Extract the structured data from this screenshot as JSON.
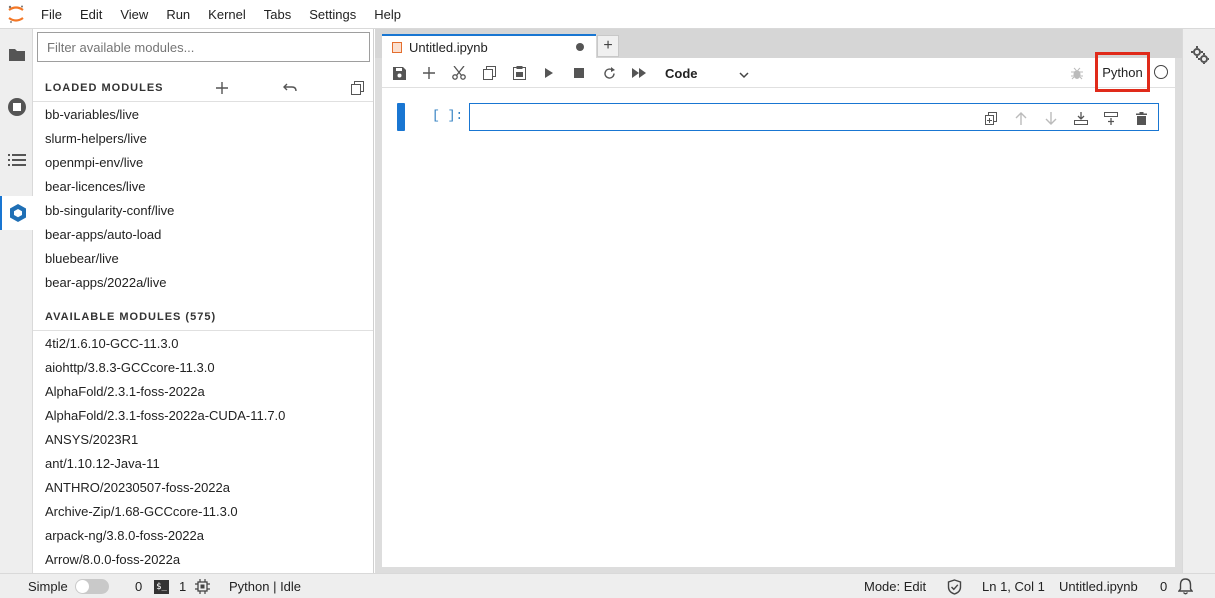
{
  "menu": [
    "File",
    "Edit",
    "View",
    "Run",
    "Kernel",
    "Tabs",
    "Settings",
    "Help"
  ],
  "sidebar": {
    "filter_placeholder": "Filter available modules...",
    "loaded_title": "LOADED MODULES",
    "loaded_modules": [
      "bb-variables/live",
      "slurm-helpers/live",
      "openmpi-env/live",
      "bear-licences/live",
      "bb-singularity-conf/live",
      "bear-apps/auto-load",
      "bluebear/live",
      "bear-apps/2022a/live"
    ],
    "available_title": "AVAILABLE MODULES (575)",
    "available_modules": [
      "4ti2/1.6.10-GCC-11.3.0",
      "aiohttp/3.8.3-GCCcore-11.3.0",
      "AlphaFold/2.3.1-foss-2022a",
      "AlphaFold/2.3.1-foss-2022a-CUDA-11.7.0",
      "ANSYS/2023R1",
      "ant/1.10.12-Java-11",
      "ANTHRO/20230507-foss-2022a",
      "Archive-Zip/1.68-GCCcore-11.3.0",
      "arpack-ng/3.8.0-foss-2022a",
      "Arrow/8.0.0-foss-2022a"
    ]
  },
  "notebook": {
    "tab_title": "Untitled.ipynb",
    "cell_type": "Code",
    "kernel_name": "Python",
    "cell_prompt": "[ ]:"
  },
  "status": {
    "mode_toggle_label": "Simple",
    "terminals_count": "0",
    "kernels_count": "1",
    "kernel_status": "Python | Idle",
    "mode": "Mode: Edit",
    "cursor": "Ln 1, Col 1",
    "filename": "Untitled.ipynb",
    "notifications": "0"
  },
  "colors": {
    "accent": "#1976d2",
    "highlight_box": "#e02a1a",
    "jupyter_orange": "#f37726"
  }
}
